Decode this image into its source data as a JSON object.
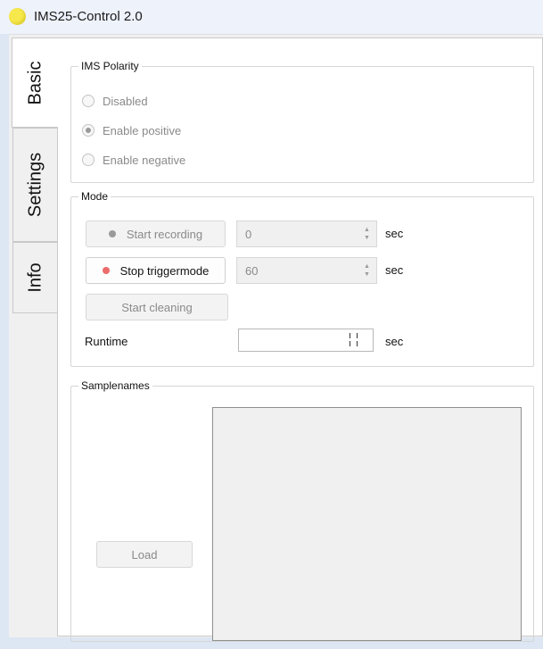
{
  "window": {
    "title": "IMS25-Control 2.0"
  },
  "tabs": [
    {
      "label": "Basic",
      "active": true
    },
    {
      "label": "Settings",
      "active": false
    },
    {
      "label": "Info",
      "active": false
    }
  ],
  "polarity": {
    "title": "IMS Polarity",
    "options": [
      {
        "label": "Disabled",
        "checked": false
      },
      {
        "label": "Enable positive",
        "checked": true
      },
      {
        "label": "Enable negative",
        "checked": false
      }
    ]
  },
  "mode": {
    "title": "Mode",
    "start_recording": {
      "label": "Start recording",
      "dot_color": "#9a9a9a",
      "value": "0",
      "unit": "sec"
    },
    "stop_trigger": {
      "label": "Stop triggermode",
      "dot_color": "#ec6b6b",
      "value": "60",
      "unit": "sec"
    },
    "start_cleaning": {
      "label": "Start cleaning"
    },
    "runtime": {
      "label": "Runtime",
      "unit": "sec"
    }
  },
  "samplenames": {
    "title": "Samplenames",
    "load_label": "Load"
  }
}
